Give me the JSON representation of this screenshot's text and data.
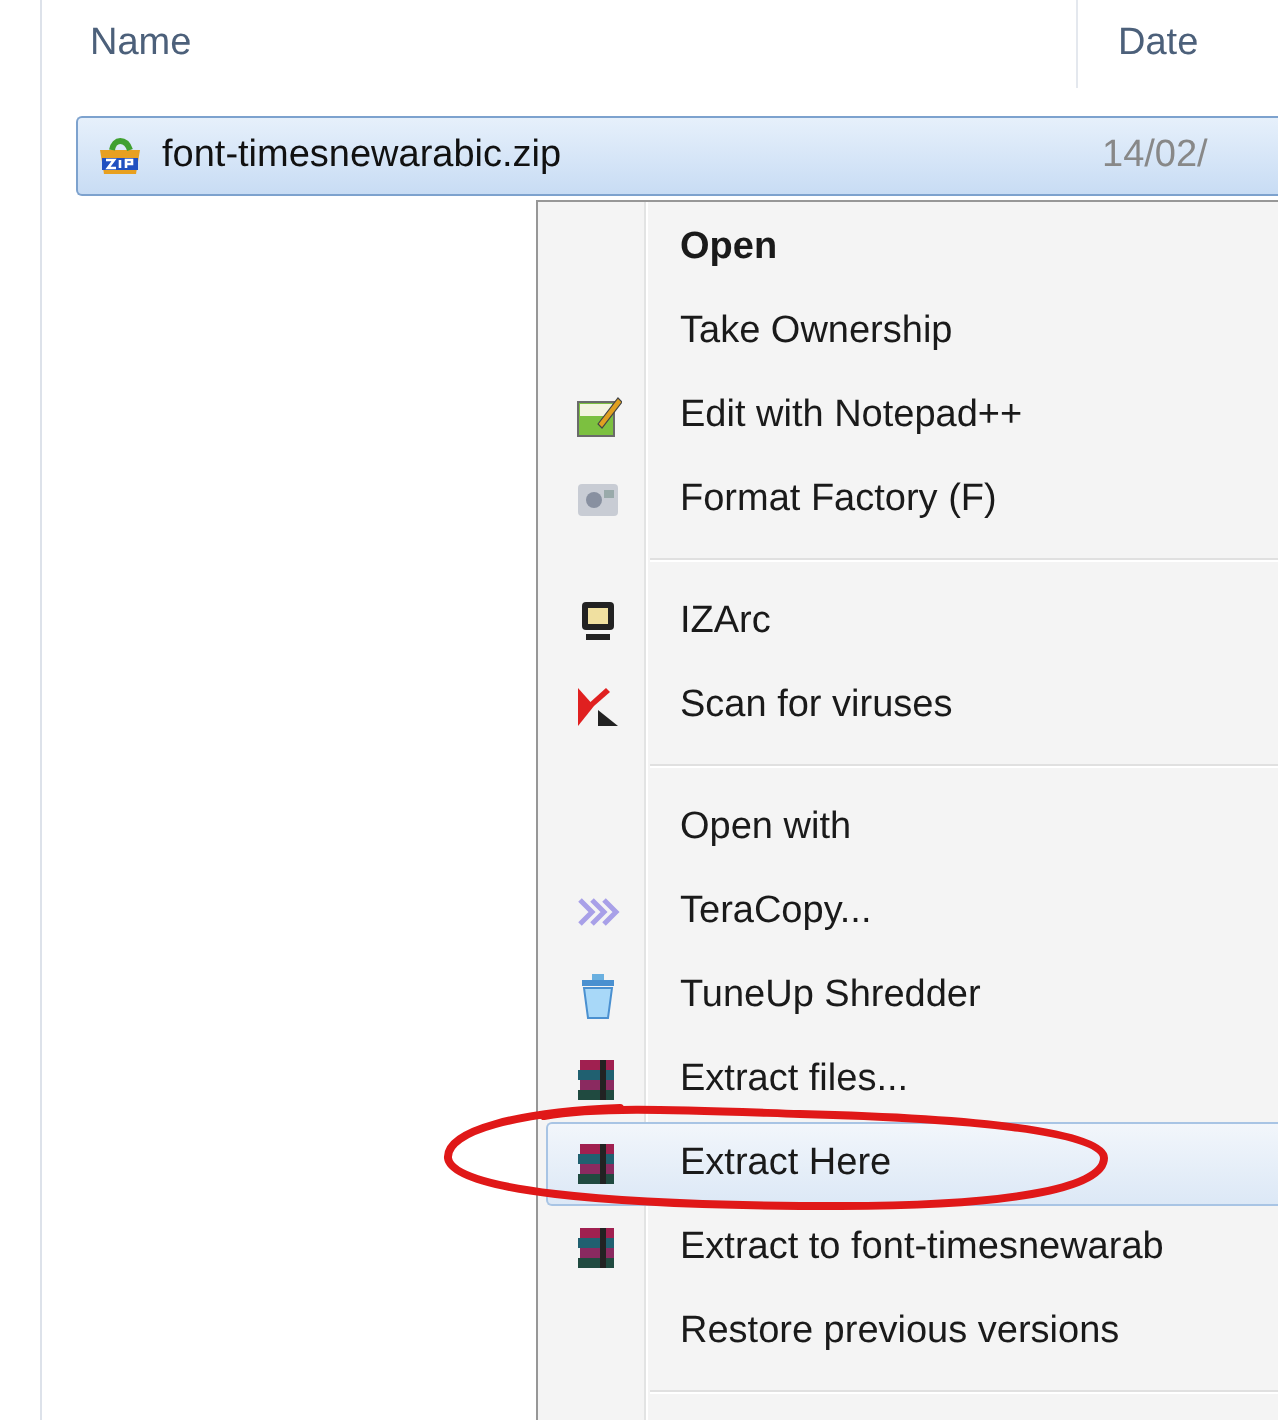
{
  "columns": [
    {
      "label": "Name"
    },
    {
      "label": "Date"
    }
  ],
  "file": {
    "name": "font-timesnewarabic.zip",
    "date": "14/02/",
    "selected": true
  },
  "context_menu": [
    {
      "kind": "plain",
      "label": "Open",
      "default": true,
      "selected": false
    },
    {
      "kind": "plain",
      "label": "Take Ownership",
      "default": false,
      "selected": false
    },
    {
      "kind": "notepad",
      "label": "Edit with Notepad++",
      "default": false,
      "selected": false
    },
    {
      "kind": "media",
      "label": "Format Factory (F)",
      "default": false,
      "selected": false
    },
    {
      "kind": "separator"
    },
    {
      "kind": "monitor",
      "label": "IZArc",
      "default": false,
      "selected": false
    },
    {
      "kind": "antivirus",
      "label": "Scan for viruses",
      "default": false,
      "selected": false
    },
    {
      "kind": "separator"
    },
    {
      "kind": "plain",
      "label": "Open with",
      "default": false,
      "selected": false
    },
    {
      "kind": "chevrons",
      "label": "TeraCopy...",
      "default": false,
      "selected": false
    },
    {
      "kind": "trash",
      "label": "TuneUp Shredder",
      "default": false,
      "selected": false
    },
    {
      "kind": "archive",
      "label": "Extract files...",
      "default": false,
      "selected": false
    },
    {
      "kind": "archive",
      "label": "Extract Here",
      "default": false,
      "selected": true
    },
    {
      "kind": "archive",
      "label": "Extract to font-timesnewarab",
      "default": false,
      "selected": false
    },
    {
      "kind": "plain",
      "label": "Restore previous versions",
      "default": false,
      "selected": false
    },
    {
      "kind": "separator"
    }
  ],
  "annotation": {
    "kind": "ellipse"
  }
}
